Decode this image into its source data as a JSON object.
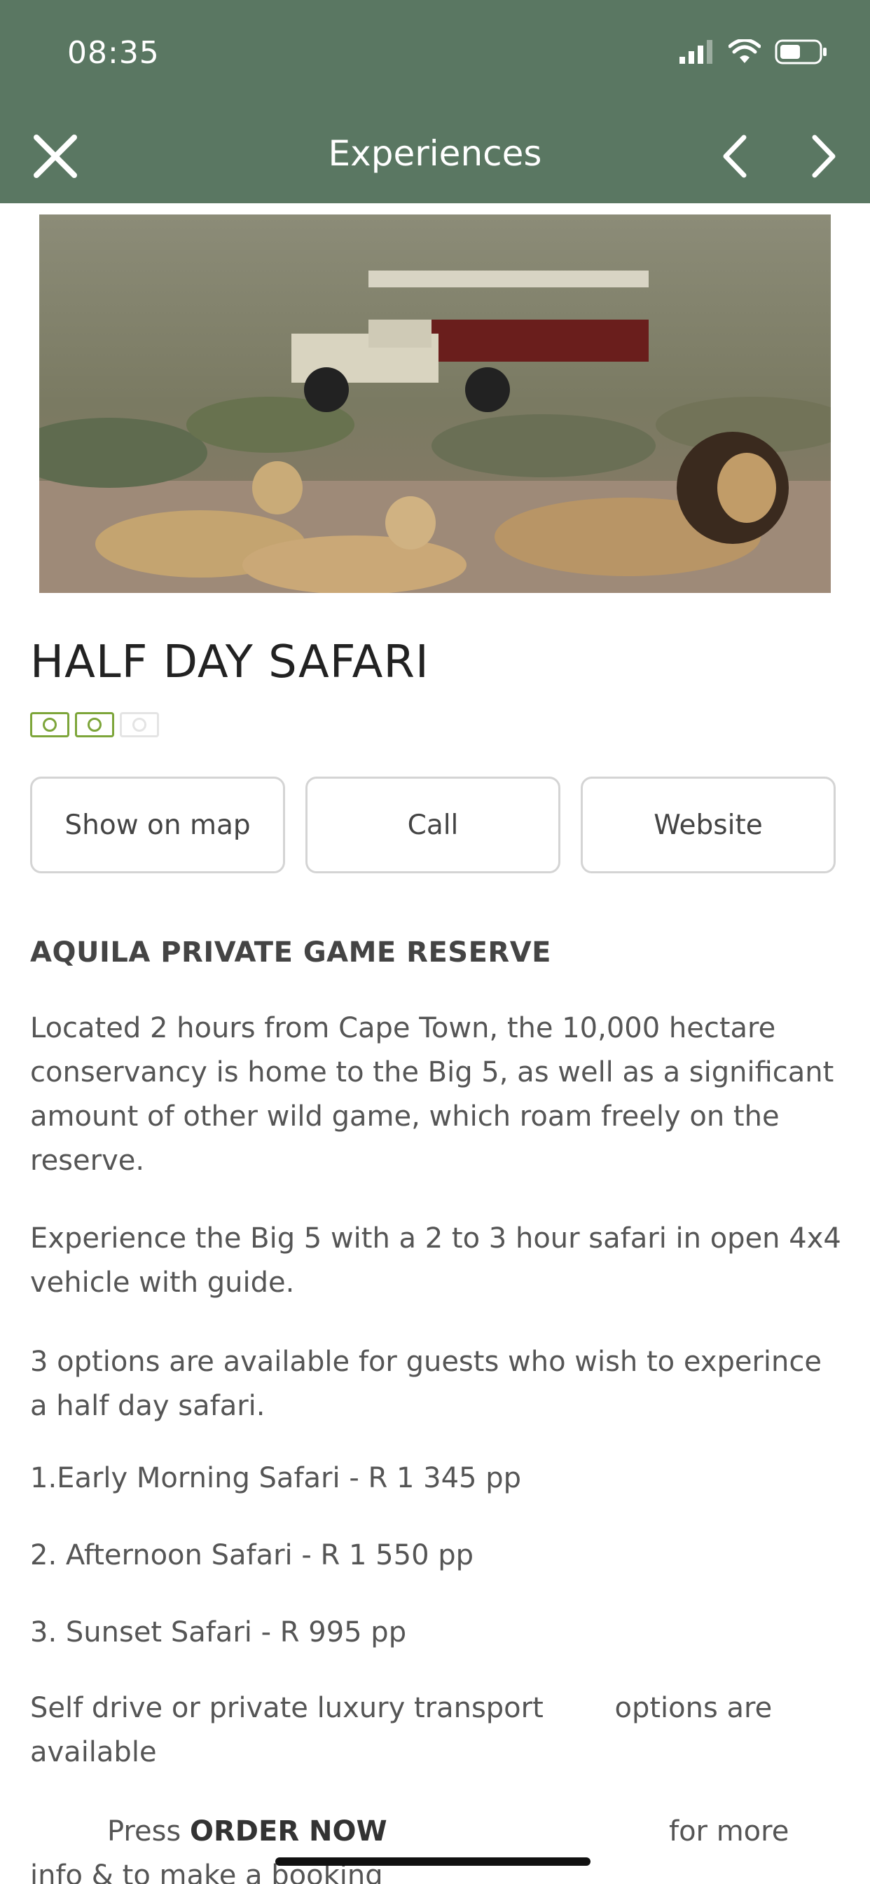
{
  "status_bar": {
    "time": "08:35"
  },
  "nav": {
    "title": "Experiences"
  },
  "hero_image": {
    "alt": "Lions resting in front of an open safari vehicle"
  },
  "listing": {
    "title": "HALF DAY SAFARI",
    "price_level": {
      "filled": 2,
      "total": 3
    }
  },
  "actions": {
    "map_label": "Show on map",
    "call_label": "Call",
    "website_label": "Website"
  },
  "content": {
    "heading": "AQUILA PRIVATE GAME RESERVE",
    "p1": "Located 2 hours from Cape Town, the 10,000 hectare conservancy is home to the Big 5, as well as a significant amount of other wild game, which roam freely on the reserve.",
    "p2": "Experience the Big 5 with a 2 to 3 hour safari in open 4x4 vehicle with guide.",
    "p3": "3 options are available for guests who wish to experince a half day safari.",
    "opt1": "1.Early Morning Safari -  R 1 345 pp",
    "opt2": "2. Afternoon Safari  - R 1 550 pp",
    "opt3": "3. Sunset Safari  - R 995 pp",
    "p4": "Self drive or private luxury transport        options are available",
    "press_prefix": "Press ",
    "press_bold": "ORDER NOW",
    "press_suffix": "for more",
    "press_line2": "info & to make a booking"
  },
  "colors": {
    "header": "#5a7762",
    "price_active": "#7da53a"
  }
}
